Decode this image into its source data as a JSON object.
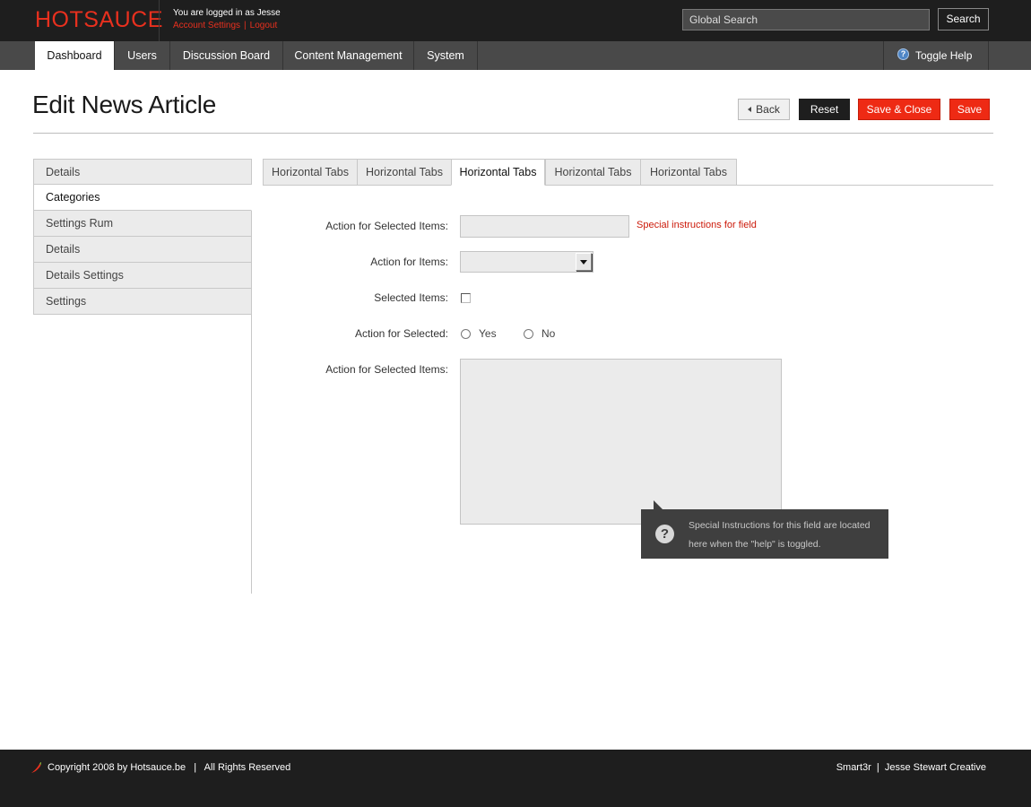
{
  "header": {
    "logo": "HOTSAUCE",
    "login_text": "You are logged in as Jesse",
    "account_settings": "Account Settings",
    "link_separator": "|",
    "logout": "Logout",
    "search_placeholder": "Global Search",
    "search_button": "Search"
  },
  "nav": {
    "items": [
      {
        "label": "Dashboard"
      },
      {
        "label": "Users"
      },
      {
        "label": "Discussion Board"
      },
      {
        "label": "Content Management"
      },
      {
        "label": "System"
      }
    ],
    "active": "Dashboard",
    "toggle_help": "Toggle Help",
    "help_icon": "question-circle-icon"
  },
  "page": {
    "title": "Edit News Article",
    "buttons": {
      "back": "Back",
      "reset": "Reset",
      "save_close": "Save & Close",
      "save": "Save"
    }
  },
  "sidemenu": {
    "items": [
      {
        "label": "Details"
      },
      {
        "label": "Categories"
      },
      {
        "label": "Settings Rum"
      },
      {
        "label": "Details"
      },
      {
        "label": "Details Settings"
      },
      {
        "label": "Settings"
      }
    ],
    "active_index": 1
  },
  "tabs": {
    "items": [
      {
        "label": "Horizontal Tabs"
      },
      {
        "label": "Horizontal Tabs"
      },
      {
        "label": "Horizontal Tabs"
      },
      {
        "label": "Horizontal Tabs"
      },
      {
        "label": "Horizontal Tabs"
      }
    ],
    "active_index": 2
  },
  "form": {
    "field1_label": "Action for Selected Items:",
    "field1_value": "",
    "field1_instructions": "Special instructions for field",
    "field2_label": "Action for Items:",
    "field2_value": "",
    "field3_label": "Selected Items:",
    "field3_checked": false,
    "field4_label": "Action for Selected:",
    "radio_yes": "Yes",
    "radio_no": "No",
    "field5_label": "Action for Selected Items:",
    "field5_value": ""
  },
  "help_tooltip": {
    "icon": "question-mark-icon",
    "text": "Special Instructions for this field are located here when the \"help\" is toggled."
  },
  "footer": {
    "left": "Copyright 2008 by Hotsauce.be   |   All Rights Reserved",
    "right": "Smart3r  |  Jesse Stewart Creative",
    "icon": "chili-pepper-icon"
  },
  "colors": {
    "brand_red": "#ee2a14",
    "topbar": "#1e1e1e",
    "navbar": "#494949",
    "field_bg": "#ebebeb"
  }
}
